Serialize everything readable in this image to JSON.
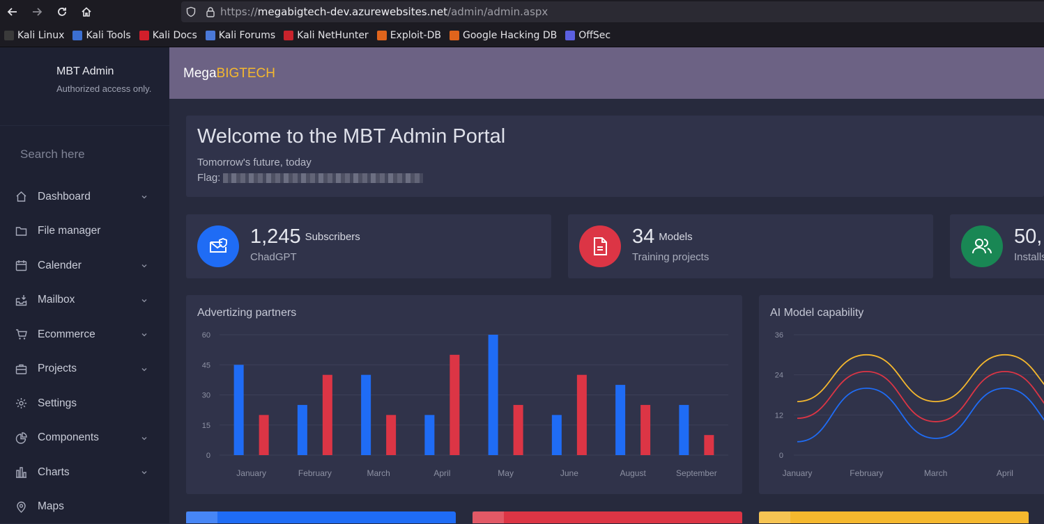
{
  "browser": {
    "url_proto": "https://",
    "url_host": "megabigtech-dev.azurewebsites.net",
    "url_path": "/admin/admin.aspx",
    "bookmarks": [
      {
        "label": "Kali Linux",
        "color": "#3a3a3a"
      },
      {
        "label": "Kali Tools",
        "color": "#3b6fd1"
      },
      {
        "label": "Kali Docs",
        "color": "#d21f2b"
      },
      {
        "label": "Kali Forums",
        "color": "#4a78d8"
      },
      {
        "label": "Kali NetHunter",
        "color": "#c8232c"
      },
      {
        "label": "Exploit-DB",
        "color": "#e0641c"
      },
      {
        "label": "Google Hacking DB",
        "color": "#e0641c"
      },
      {
        "label": "OffSec",
        "color": "#5b5fe0"
      }
    ]
  },
  "sidebar": {
    "brand_name": "MBT Admin",
    "brand_sub": "Authorized access only.",
    "search_placeholder": "Search here",
    "items": [
      {
        "label": "Dashboard",
        "icon": "home-icon",
        "chevron": true
      },
      {
        "label": "File manager",
        "icon": "folder-icon",
        "chevron": false
      },
      {
        "label": "Calender",
        "icon": "calendar-icon",
        "chevron": true
      },
      {
        "label": "Mailbox",
        "icon": "mailbox-icon",
        "chevron": true
      },
      {
        "label": "Ecommerce",
        "icon": "cart-icon",
        "chevron": true
      },
      {
        "label": "Projects",
        "icon": "briefcase-icon",
        "chevron": true
      },
      {
        "label": "Settings",
        "icon": "gear-icon",
        "chevron": false
      },
      {
        "label": "Components",
        "icon": "pie-icon",
        "chevron": true
      },
      {
        "label": "Charts",
        "icon": "bar-chart-icon",
        "chevron": true
      },
      {
        "label": "Maps",
        "icon": "map-pin-icon",
        "chevron": false
      }
    ]
  },
  "header": {
    "logo_main": "Mega",
    "logo_accent": "BIGTECH"
  },
  "welcome": {
    "title": "Welcome to the MBT Admin Portal",
    "tagline": "Tomorrow's future, today",
    "flag_label": "Flag:"
  },
  "stats": [
    {
      "value": "1,245",
      "unit": "Subscribers",
      "desc": "ChadGPT",
      "color": "#1f6cf5",
      "icon": "mail-shield-icon"
    },
    {
      "value": "34",
      "unit": "Models",
      "desc": "Training projects",
      "color": "#dc3545",
      "icon": "document-icon"
    },
    {
      "value": "50,",
      "unit": "",
      "desc": "Installs",
      "color": "#198754",
      "icon": "users-icon"
    }
  ],
  "colors": {
    "blue": "#1f6cf5",
    "red": "#dc3545",
    "yellow": "#f5b82e",
    "purple_band": "#6c6284"
  },
  "chart_data": [
    {
      "type": "bar",
      "title": "Advertizing partners",
      "categories": [
        "January",
        "February",
        "March",
        "April",
        "May",
        "June",
        "August",
        "September"
      ],
      "series": [
        {
          "values": [
            45,
            25,
            40,
            20,
            60,
            20,
            35,
            25
          ]
        },
        {
          "values": [
            20,
            40,
            20,
            50,
            25,
            40,
            25,
            10
          ]
        }
      ],
      "ylim": [
        0,
        60
      ],
      "yticks": [
        0,
        15,
        30,
        45,
        60
      ],
      "grid": true
    },
    {
      "type": "line",
      "title": "AI Model capability",
      "categories": [
        "January",
        "February",
        "March",
        "April"
      ],
      "series": [
        {
          "color": "#f5b82e",
          "values": [
            16,
            30,
            16,
            30
          ]
        },
        {
          "color": "#dc3545",
          "values": [
            11,
            25,
            10,
            25
          ]
        },
        {
          "color": "#1f6cf5",
          "values": [
            4,
            20,
            5,
            20
          ]
        }
      ],
      "ylim": [
        0,
        36
      ],
      "yticks": [
        0,
        12,
        24,
        36
      ],
      "grid": true
    }
  ]
}
